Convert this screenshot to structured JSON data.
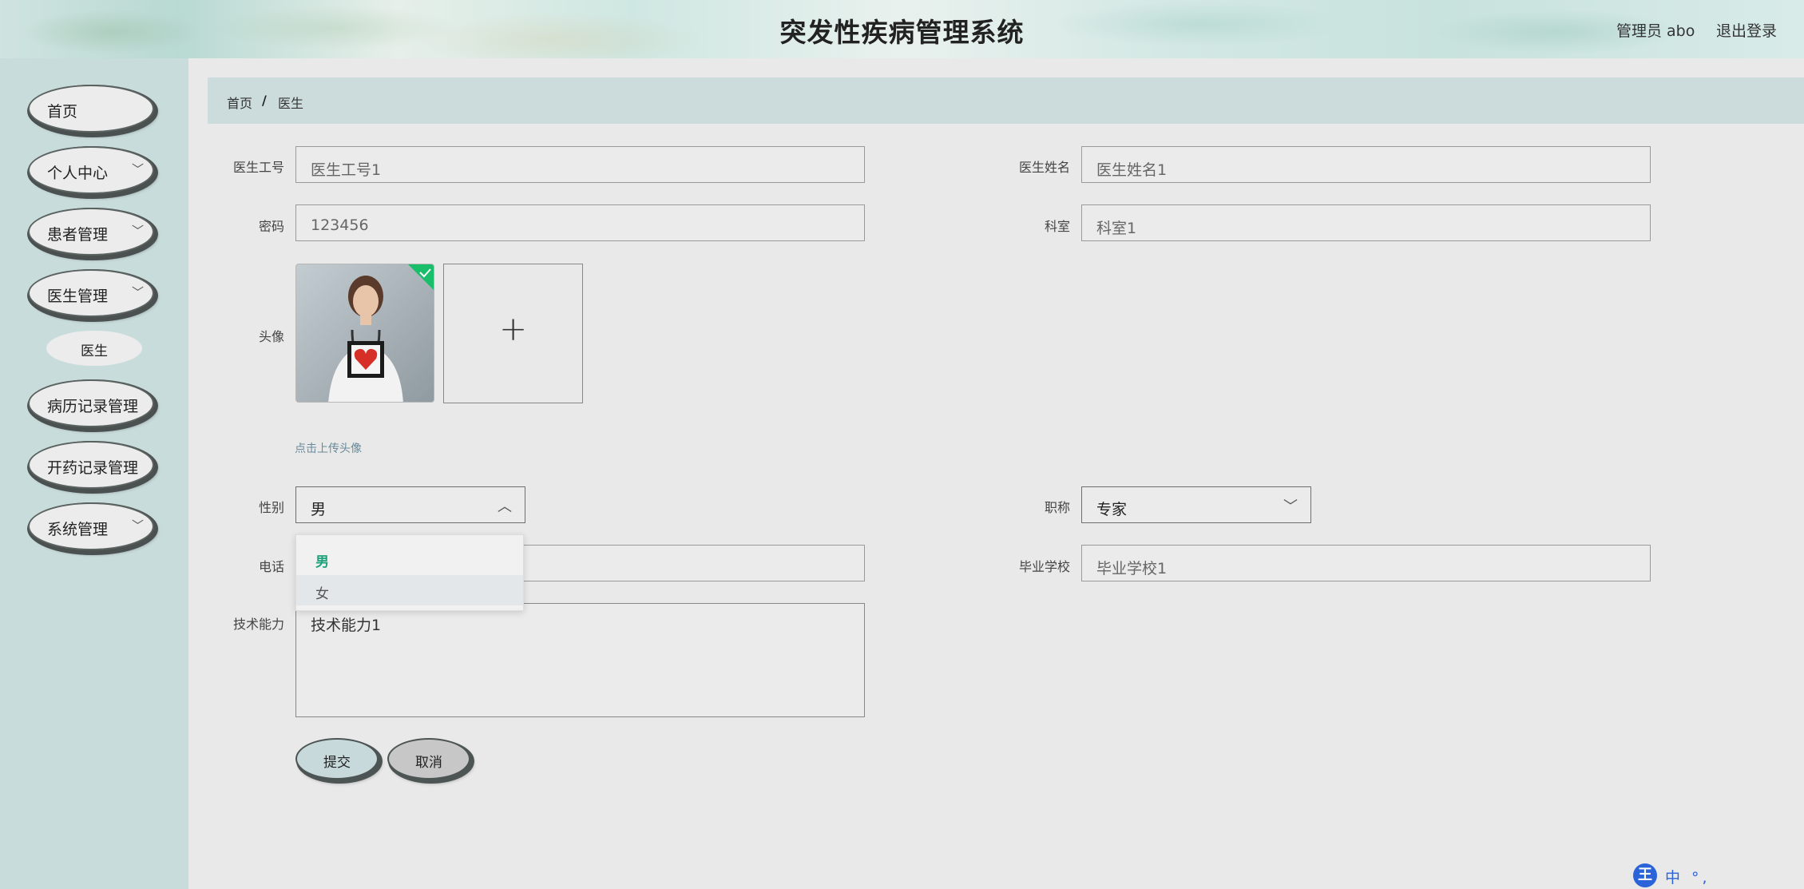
{
  "header": {
    "title": "突发性疾病管理系统",
    "user": "管理员 abo",
    "logout": "退出登录"
  },
  "sidebar": {
    "items": [
      {
        "label": "首页",
        "has_chevron": false
      },
      {
        "label": "个人中心",
        "has_chevron": true
      },
      {
        "label": "患者管理",
        "has_chevron": true
      },
      {
        "label": "医生管理",
        "has_chevron": true
      },
      {
        "label": "病历记录管理",
        "has_chevron": false
      },
      {
        "label": "开药记录管理",
        "has_chevron": false
      },
      {
        "label": "系统管理",
        "has_chevron": true
      }
    ],
    "sub_item": "医生"
  },
  "breadcrumb": {
    "home": "首页",
    "separator": "/",
    "current": "医生"
  },
  "form": {
    "doctor_id": {
      "label": "医生工号",
      "value": "医生工号1"
    },
    "doctor_name": {
      "label": "医生姓名",
      "value": "医生姓名1"
    },
    "password": {
      "label": "密码",
      "value": "123456"
    },
    "department": {
      "label": "科室",
      "value": "科室1"
    },
    "avatar": {
      "label": "头像",
      "upload_tip": "点击上传头像"
    },
    "gender": {
      "label": "性别",
      "value": "男",
      "options": [
        "男",
        "女"
      ]
    },
    "title": {
      "label": "职称",
      "value": "专家"
    },
    "phone": {
      "label": "电话",
      "value": ""
    },
    "school": {
      "label": "毕业学校",
      "value": "毕业学校1"
    },
    "skill": {
      "label": "技术能力",
      "value": "技术能力1"
    },
    "submit": "提交",
    "cancel": "取消"
  },
  "ime": {
    "logo": "王",
    "status": "中 °,"
  },
  "colors": {
    "sidebar_bg": "#c9dcdc",
    "breadcrumb_bg": "#ccdcdd",
    "selected_option": "#1ea27c",
    "upload_check": "#19be6b"
  }
}
